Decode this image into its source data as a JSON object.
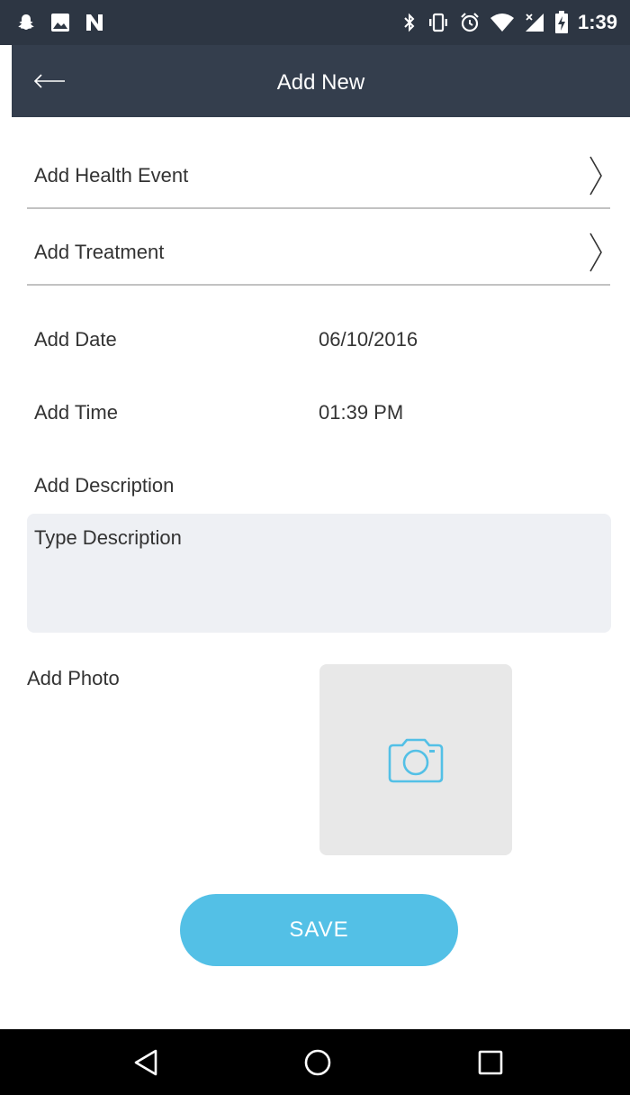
{
  "status_bar": {
    "time": "1:39",
    "left_icons": [
      "snapchat-icon",
      "image-icon",
      "n-logo-icon"
    ],
    "right_icons": [
      "bluetooth-icon",
      "vibrate-icon",
      "alarm-icon",
      "wifi-icon",
      "cell-signal-icon",
      "battery-icon"
    ]
  },
  "header": {
    "title": "Add New",
    "back_icon": "arrow-left-icon"
  },
  "form": {
    "health_event_label": "Add Health Event",
    "treatment_label": "Add Treatment",
    "date_label": "Add Date",
    "date_value": "06/10/2016",
    "time_label": "Add Time",
    "time_value": "01:39 PM",
    "description_label": "Add Description",
    "description_placeholder": "Type Description",
    "photo_label": "Add Photo",
    "camera_icon": "camera-icon",
    "save_label": "SAVE"
  },
  "bottom_nav": {
    "icons": [
      "back-triangle-icon",
      "home-circle-icon",
      "recents-square-icon"
    ]
  },
  "colors": {
    "status_bar_bg": "#2d3643",
    "header_bg": "#343e4d",
    "accent": "#53c0e6",
    "description_bg": "#eef0f4",
    "photo_bg": "#e8e8e8"
  }
}
